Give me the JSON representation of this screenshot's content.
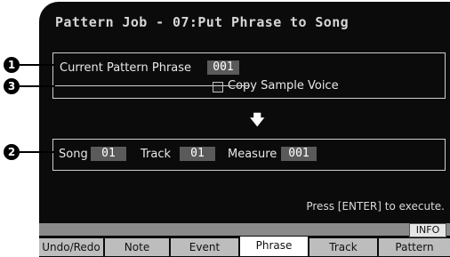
{
  "title": "Pattern Job - 07:Put Phrase to Song",
  "phrase_box": {
    "label": "Current Pattern Phrase",
    "value": "001",
    "checkbox_label": "Copy Sample Voice"
  },
  "arrow": "🡇",
  "song_box": {
    "song_label": "Song",
    "song_value": "01",
    "track_label": "Track",
    "track_value": "01",
    "measure_label": "Measure",
    "measure_value": "001"
  },
  "hint": "Press [ENTER] to execute.",
  "info_label": "INFO",
  "tabs": [
    "Undo/Redo",
    "Note",
    "Event",
    "Phrase",
    "Track",
    "Pattern"
  ],
  "active_tab": "Phrase",
  "callouts": [
    "1",
    "2",
    "3"
  ]
}
